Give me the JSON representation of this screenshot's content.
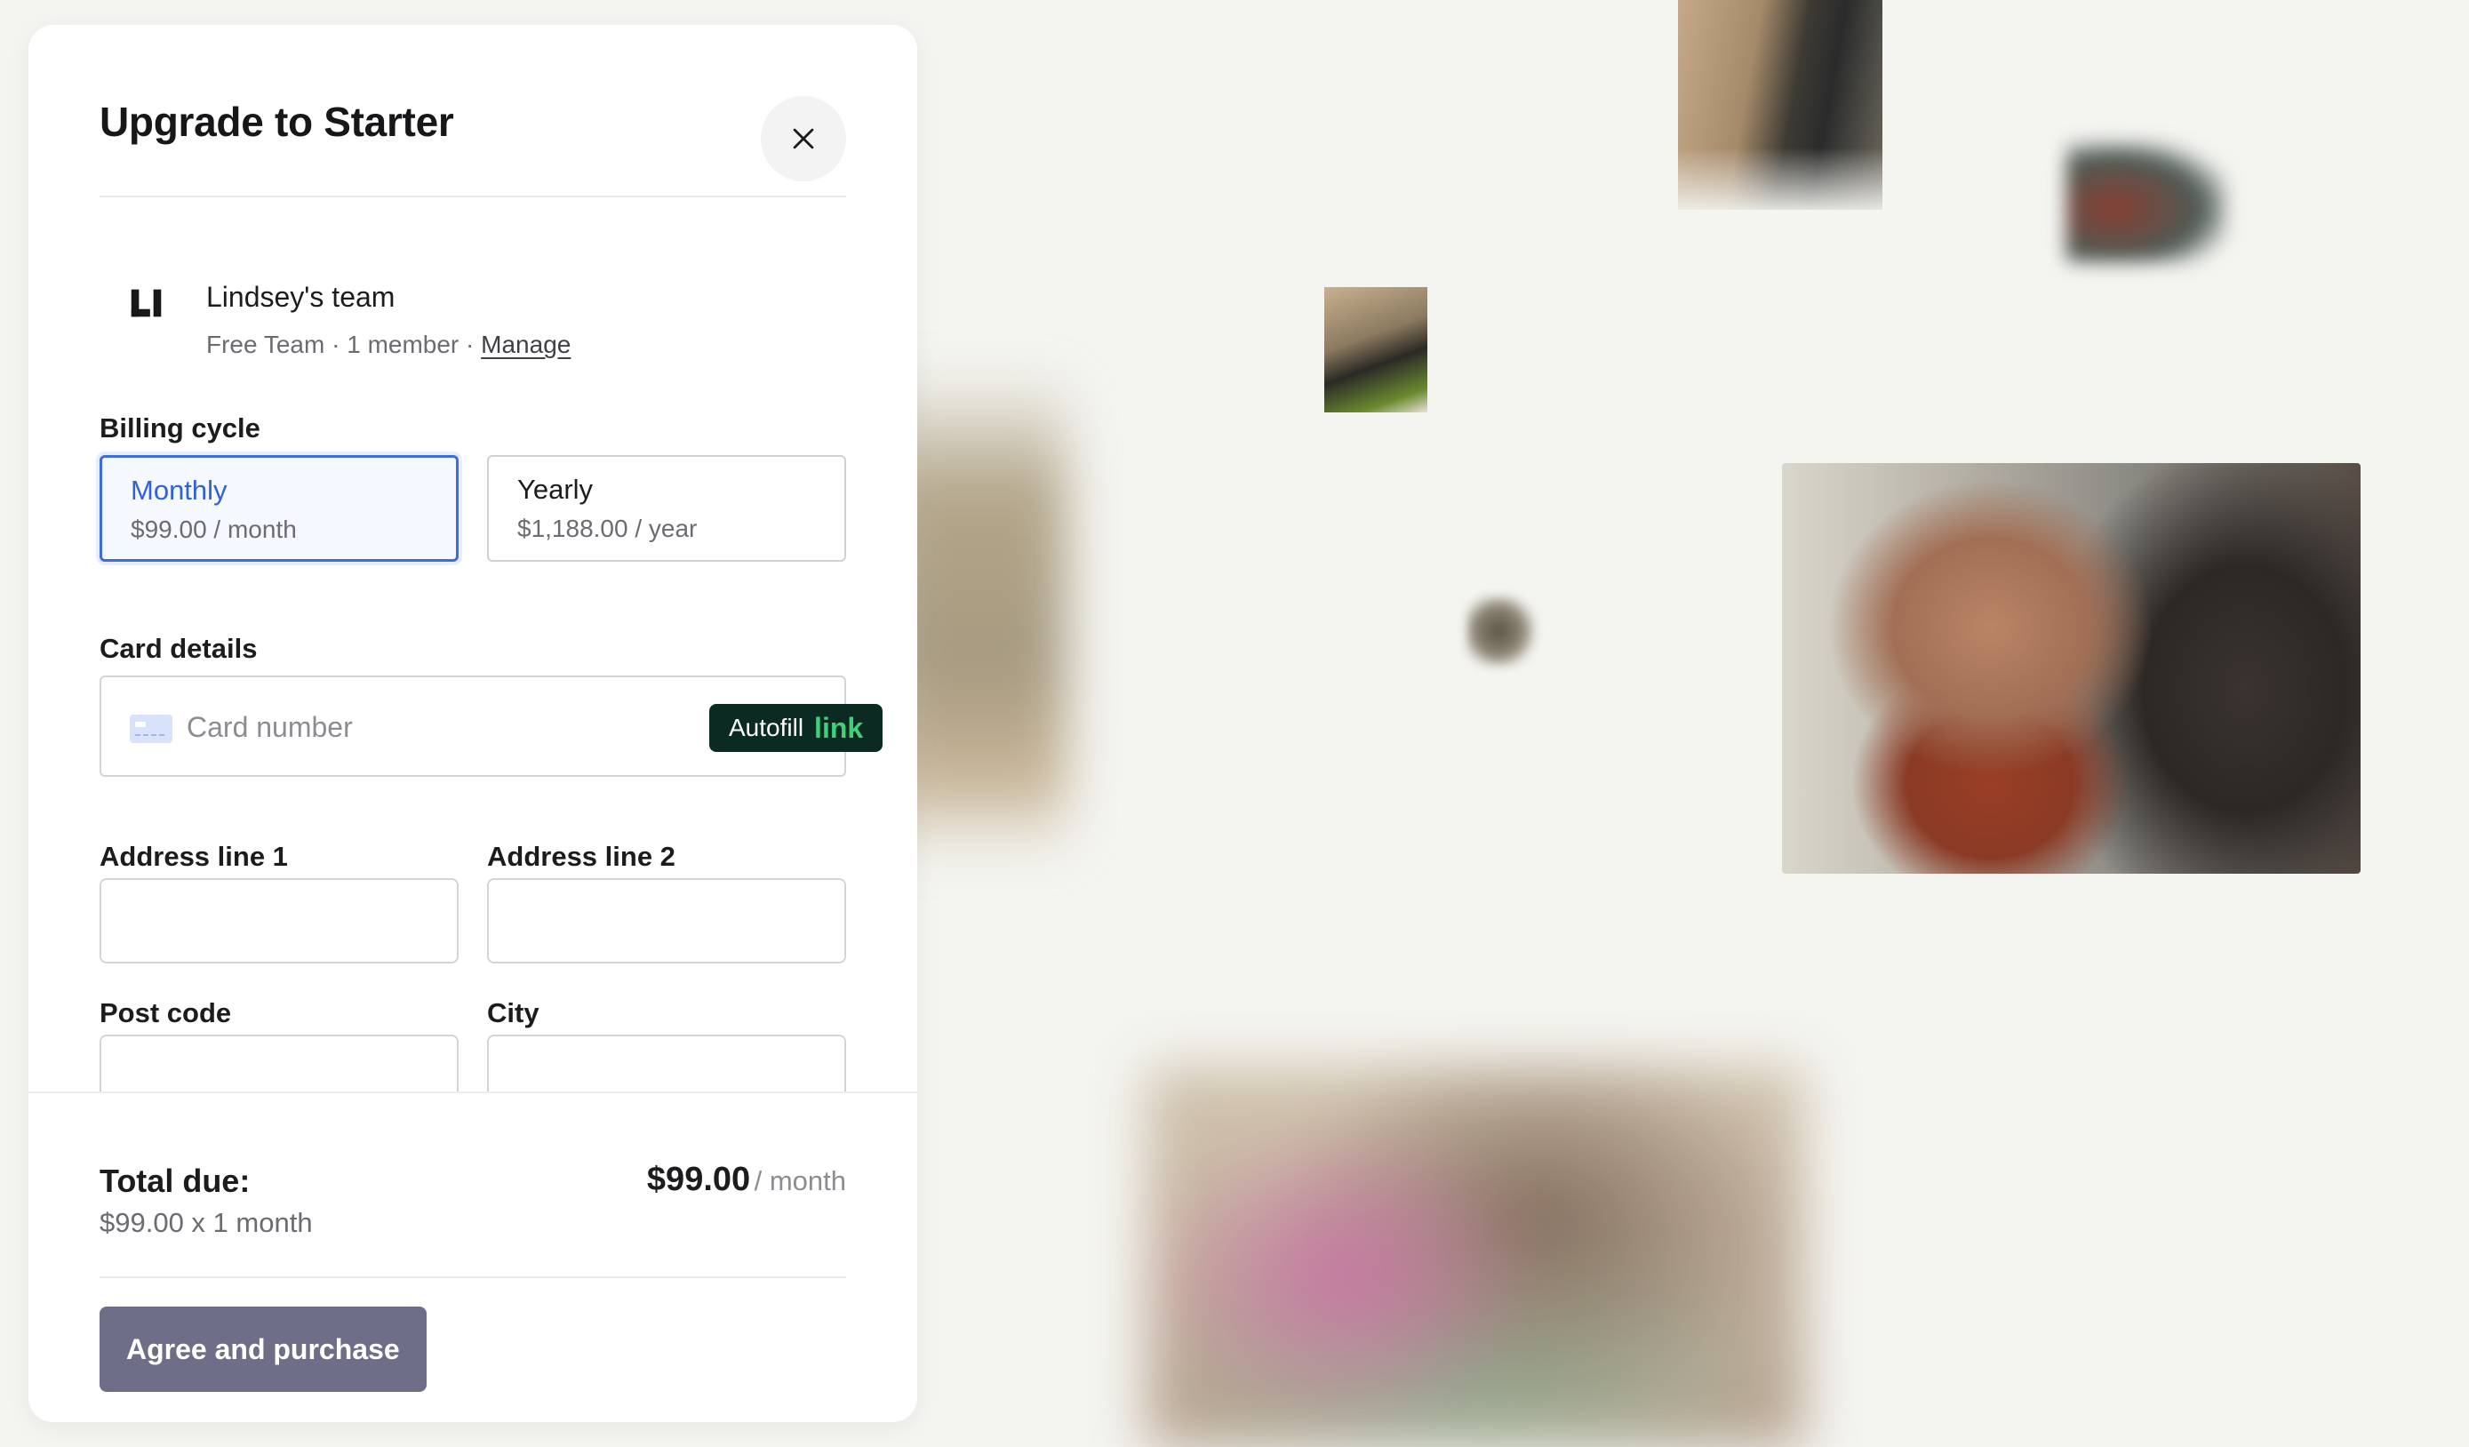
{
  "modal": {
    "title": "Upgrade to Starter",
    "close_icon": "close-icon"
  },
  "team": {
    "logo_text": "LI",
    "name": "Lindsey's team",
    "plan": "Free Team",
    "separator": "·",
    "members": "1 member",
    "manage_label": "Manage"
  },
  "billing": {
    "label": "Billing cycle",
    "options": [
      {
        "label": "Monthly",
        "price": "$99.00 / month",
        "selected": true
      },
      {
        "label": "Yearly",
        "price": "$1,188.00 / year",
        "selected": false
      }
    ]
  },
  "card": {
    "label": "Card details",
    "placeholder": "Card number",
    "autofill_text": "Autofill",
    "autofill_brand": "link",
    "icon": "credit-card-icon"
  },
  "address": {
    "line1_label": "Address line 1",
    "line1_value": "",
    "line2_label": "Address line 2",
    "line2_value": "",
    "postcode_label": "Post code",
    "postcode_value": "",
    "city_label": "City",
    "city_value": ""
  },
  "footer": {
    "total_label": "Total due:",
    "total_breakdown": "$99.00 x 1 month",
    "amount": "$99.00",
    "period": "/ month",
    "purchase_label": "Agree and purchase"
  },
  "colors": {
    "accent": "#3b6de0",
    "button": "#6e6e88",
    "link_brand_bg": "#0b2b22",
    "link_brand_fg": "#3fd07a",
    "background": "#f4f4f0"
  }
}
